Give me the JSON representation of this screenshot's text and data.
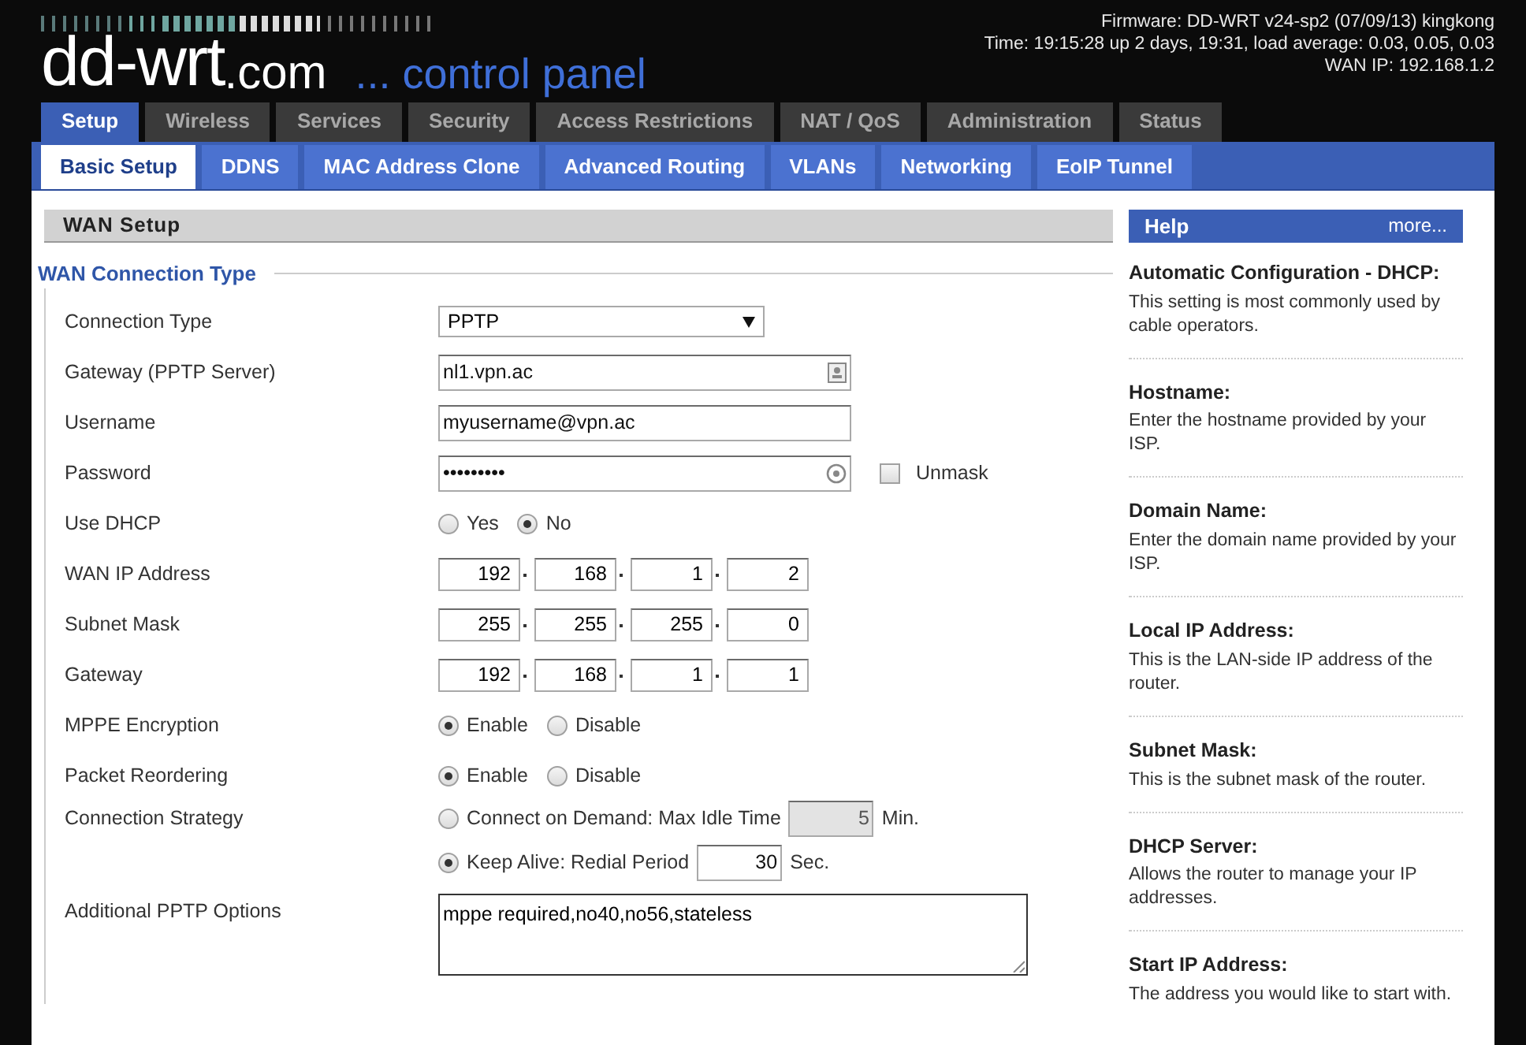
{
  "header": {
    "logo_main": "dd-wrt",
    "logo_suffix": ".com",
    "tagline": "... control panel",
    "info": [
      "Firmware: DD-WRT v24-sp2 (07/09/13) kingkong",
      "Time: 19:15:28 up 2 days, 19:31, load average: 0.03, 0.05, 0.03",
      "WAN IP: 192.168.1.2"
    ]
  },
  "tabs": [
    {
      "label": "Setup",
      "selected": true
    },
    {
      "label": "Wireless",
      "selected": false
    },
    {
      "label": "Services",
      "selected": false
    },
    {
      "label": "Security",
      "selected": false
    },
    {
      "label": "Access Restrictions",
      "selected": false
    },
    {
      "label": "NAT / QoS",
      "selected": false
    },
    {
      "label": "Administration",
      "selected": false
    },
    {
      "label": "Status",
      "selected": false
    }
  ],
  "subtabs": [
    {
      "label": "Basic Setup",
      "selected": true
    },
    {
      "label": "DDNS",
      "selected": false
    },
    {
      "label": "MAC Address Clone",
      "selected": false
    },
    {
      "label": "Advanced Routing",
      "selected": false
    },
    {
      "label": "VLANs",
      "selected": false
    },
    {
      "label": "Networking",
      "selected": false
    },
    {
      "label": "EoIP Tunnel",
      "selected": false
    }
  ],
  "section": {
    "title": "WAN Setup",
    "group": "WAN Connection Type",
    "rows": [
      {
        "kind": "select",
        "label": "Connection Type",
        "value": "PPTP"
      },
      {
        "kind": "server",
        "label": "Gateway (PPTP Server)",
        "value": "nl1.vpn.ac"
      },
      {
        "kind": "text",
        "label": "Username",
        "value": "myusername@vpn.ac"
      },
      {
        "kind": "password",
        "label": "Password",
        "value": "•••••••••",
        "unmask": {
          "label": "Unmask",
          "checked": false
        }
      },
      {
        "kind": "radio",
        "label": "Use DHCP",
        "options": [
          {
            "label": "Yes",
            "selected": false
          },
          {
            "label": "No",
            "selected": true
          }
        ]
      },
      {
        "kind": "ip",
        "label": "WAN IP Address",
        "octets": [
          "192",
          "168",
          "1",
          "2"
        ]
      },
      {
        "kind": "ip",
        "label": "Subnet Mask",
        "octets": [
          "255",
          "255",
          "255",
          "0"
        ]
      },
      {
        "kind": "ip",
        "label": "Gateway",
        "octets": [
          "192",
          "168",
          "1",
          "1"
        ]
      },
      {
        "kind": "radio",
        "label": "MPPE Encryption",
        "options": [
          {
            "label": "Enable",
            "selected": true
          },
          {
            "label": "Disable",
            "selected": false
          }
        ]
      },
      {
        "kind": "radio",
        "label": "Packet Reordering",
        "options": [
          {
            "label": "Enable",
            "selected": true
          },
          {
            "label": "Disable",
            "selected": false
          }
        ]
      },
      {
        "kind": "strategy",
        "label": "Connection Strategy",
        "options": [
          {
            "label": "Connect on Demand: Max Idle Time",
            "selected": false,
            "value": "5",
            "unit": "Min.",
            "disabled": true
          },
          {
            "label": "Keep Alive: Redial Period",
            "selected": true,
            "value": "30",
            "unit": "Sec.",
            "disabled": false
          }
        ]
      },
      {
        "kind": "textarea",
        "label": "Additional PPTP Options",
        "value": "mppe required,no40,no56,stateless"
      }
    ]
  },
  "help": {
    "title": "Help",
    "more": "more...",
    "items": [
      {
        "title": "Automatic Configuration - DHCP:",
        "text": "This setting is most commonly used by cable operators."
      },
      {
        "title": "Hostname:",
        "text": "Enter the hostname provided by your ISP."
      },
      {
        "title": "Domain Name:",
        "text": "Enter the domain name provided by your ISP."
      },
      {
        "title": "Local IP Address:",
        "text": "This is the LAN-side IP address of the router."
      },
      {
        "title": "Subnet Mask:",
        "text": "This is the subnet mask of the router."
      },
      {
        "title": "DHCP Server:",
        "text": "Allows the router to manage your IP addresses."
      },
      {
        "title": "Start IP Address:",
        "text": "The address you would like to start with."
      }
    ]
  }
}
